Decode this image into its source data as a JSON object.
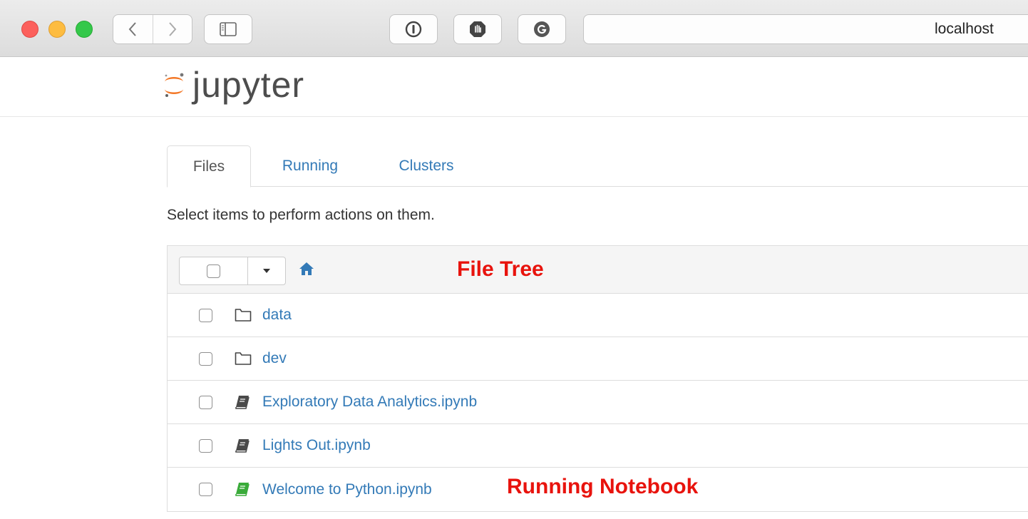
{
  "browser": {
    "address": "localhost"
  },
  "app": {
    "logo_text": "jupyter"
  },
  "tabs": [
    {
      "label": "Files",
      "active": true
    },
    {
      "label": "Running",
      "active": false
    },
    {
      "label": "Clusters",
      "active": false
    }
  ],
  "hint_text": "Select items to perform actions on them.",
  "annotations": {
    "file_tree": "File Tree",
    "running_notebook": "Running Notebook"
  },
  "files": [
    {
      "name": "data",
      "icon": "folder-icon"
    },
    {
      "name": "dev",
      "icon": "folder-icon"
    },
    {
      "name": "Exploratory Data Analytics.ipynb",
      "icon": "notebook-icon"
    },
    {
      "name": "Lights Out.ipynb",
      "icon": "notebook-icon"
    },
    {
      "name": "Welcome to Python.ipynb",
      "icon": "notebook-running-icon"
    }
  ],
  "colors": {
    "link": "#337ab7",
    "annotation": "#e8130d",
    "notebook_icon": "#4a4a4a",
    "notebook_running_icon": "#3aab3a",
    "logo_orange": "#f37726"
  }
}
